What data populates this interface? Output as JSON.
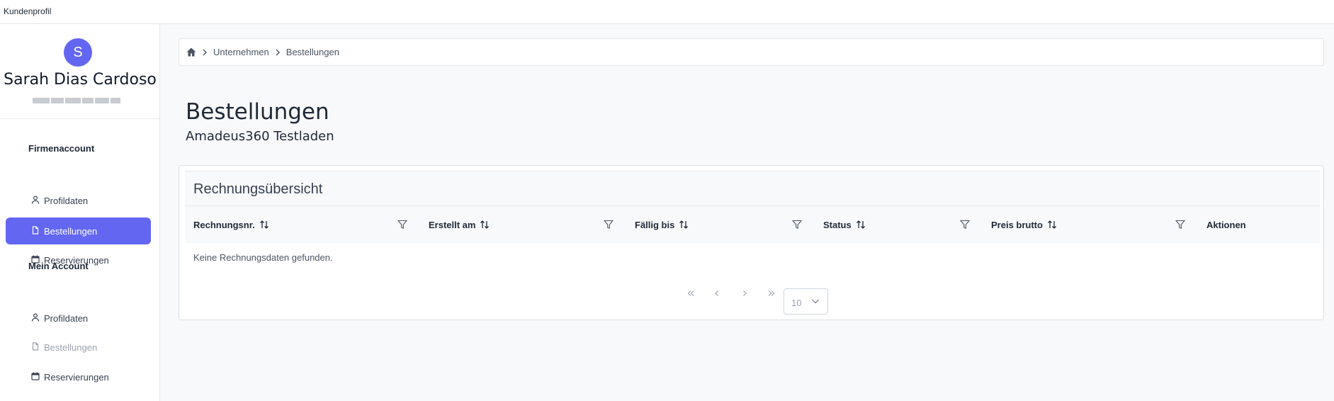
{
  "window": {
    "title": "Kundenprofil"
  },
  "user": {
    "initial": "S",
    "name": "Sarah Dias Cardoso"
  },
  "sidebar": {
    "sections": [
      {
        "label": "Firmenaccount",
        "items": [
          {
            "label": "Profildaten",
            "icon": "user-icon"
          },
          {
            "label": "Bestellungen",
            "icon": "document-icon",
            "active": true
          },
          {
            "label": "Reservierungen",
            "icon": "calendar-icon"
          }
        ]
      },
      {
        "label": "Mein Account",
        "items": [
          {
            "label": "Profildaten",
            "icon": "user-icon"
          },
          {
            "label": "Bestellungen",
            "icon": "document-icon",
            "disabled": true
          },
          {
            "label": "Reservierungen",
            "icon": "calendar-icon"
          }
        ]
      }
    ]
  },
  "breadcrumb": {
    "items": [
      "Unternehmen",
      "Bestellungen"
    ]
  },
  "page": {
    "title": "Bestellungen",
    "subtitle": "Amadeus360 Testladen"
  },
  "table": {
    "title": "Rechnungsübersicht",
    "columns": [
      "Rechnungsnr.",
      "Erstellt am",
      "Fällig bis",
      "Status",
      "Preis brutto",
      "Aktionen"
    ],
    "empty_text": "Keine Rechnungsdaten gefunden."
  },
  "pagination": {
    "rows_per_page": "10"
  },
  "colors": {
    "accent": "#6366f1"
  }
}
